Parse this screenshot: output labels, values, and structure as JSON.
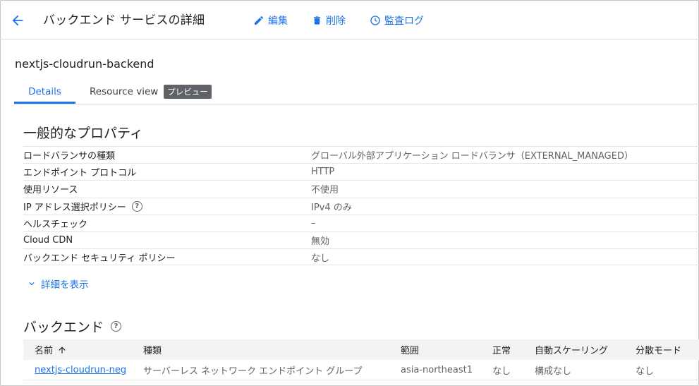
{
  "header": {
    "title": "バックエンド サービスの詳細",
    "actions": [
      {
        "label": "編集",
        "icon": "edit-icon"
      },
      {
        "label": "削除",
        "icon": "trash-icon"
      },
      {
        "label": "監査ログ",
        "icon": "history-icon"
      }
    ]
  },
  "resource_name": "nextjs-cloudrun-backend",
  "tabs": [
    {
      "label": "Details",
      "active": true
    },
    {
      "label": "Resource view",
      "badge": "プレビュー"
    }
  ],
  "general": {
    "title": "一般的なプロパティ",
    "rows": [
      {
        "key": "ロードバランサの種類",
        "value": "グローバル外部アプリケーション ロードバランサ（EXTERNAL_MANAGED）"
      },
      {
        "key": "エンドポイント プロトコル",
        "value": "HTTP"
      },
      {
        "key": "使用リソース",
        "value": "不使用"
      },
      {
        "key": "IP アドレス選択ポリシー",
        "value": "IPv4 のみ",
        "help": true
      },
      {
        "key": "ヘルスチェック",
        "value": "–"
      },
      {
        "key": "Cloud CDN",
        "value": "無効"
      },
      {
        "key": "バックエンド セキュリティ ポリシー",
        "value": "なし"
      }
    ],
    "show_more": "詳細を表示"
  },
  "backends": {
    "title": "バックエンド",
    "columns": [
      "名前",
      "種類",
      "範囲",
      "正常",
      "自動スケーリング",
      "分散モード"
    ],
    "rows": [
      [
        "nextjs-cloudrun-neg",
        "サーバーレス ネットワーク エンドポイント グループ",
        "asia-northeast1",
        "なし",
        "構成なし",
        "なし"
      ]
    ]
  },
  "colors": {
    "accent": "#1a73e8",
    "text": "#202124",
    "muted": "#5f6368"
  }
}
